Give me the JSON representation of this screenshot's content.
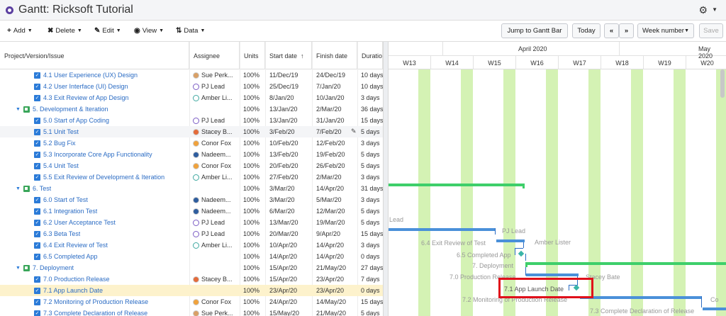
{
  "window": {
    "title": "Gantt:  Ricksoft Tutorial"
  },
  "toolbar": {
    "menus": [
      {
        "name": "add-menu",
        "icon": "plus-icon",
        "glyph": "+",
        "label": "Add"
      },
      {
        "name": "delete-menu",
        "icon": "x-circle-icon",
        "glyph": "✖",
        "label": "Delete"
      },
      {
        "name": "edit-menu",
        "icon": "pencil-icon",
        "glyph": "✎",
        "label": "Edit"
      },
      {
        "name": "view-menu",
        "icon": "eye-icon",
        "glyph": "◉",
        "label": "View"
      },
      {
        "name": "data-menu",
        "icon": "sort-icon",
        "glyph": "⇅",
        "label": "Data"
      }
    ],
    "jump_label": "Jump to Gantt Bar",
    "today_label": "Today",
    "prev_label": "«",
    "next_label": "»",
    "scale_label": "Week number",
    "save_label": "Save"
  },
  "grid": {
    "headers": {
      "issue": "Project/Version/Issue",
      "assignee": "Assignee",
      "units": "Units",
      "start": "Start date",
      "start_sort": "↑",
      "finish": "Finish date",
      "duration": "Duratio"
    },
    "rows": [
      {
        "type": "issue",
        "label": "4.1 User Experience (UX) Design",
        "assignee": "Sue Perk...",
        "avatar": "av-sue",
        "units": "100%",
        "start": "11/Dec/19",
        "finish": "24/Dec/19",
        "duration": "10 days"
      },
      {
        "type": "issue",
        "label": "4.2 User Interface (UI) Design",
        "assignee": "PJ Lead",
        "avatar": "av-pj",
        "units": "100%",
        "start": "25/Dec/19",
        "finish": "7/Jan/20",
        "duration": "10 days"
      },
      {
        "type": "issue",
        "label": "4.3 Exit Review of App Design",
        "assignee": "Amber Li...",
        "avatar": "av-amber",
        "units": "100%",
        "start": "8/Jan/20",
        "finish": "10/Jan/20",
        "duration": "3 days"
      },
      {
        "type": "version",
        "label": "5. Development & Iteration",
        "assignee": "",
        "avatar": "",
        "units": "100%",
        "start": "13/Jan/20",
        "finish": "2/Mar/20",
        "duration": "36 days"
      },
      {
        "type": "issue",
        "label": "5.0 Start of App Coding",
        "assignee": "PJ Lead",
        "avatar": "av-pj",
        "units": "100%",
        "start": "13/Jan/20",
        "finish": "31/Jan/20",
        "duration": "15 days"
      },
      {
        "type": "issue",
        "label": "5.1 Unit Test",
        "assignee": "Stacey B...",
        "avatar": "av-stacey",
        "units": "100%",
        "start": "3/Feb/20",
        "finish": "7/Feb/20",
        "duration": "5 days",
        "hover": true
      },
      {
        "type": "issue",
        "label": "5.2 Bug Fix",
        "assignee": "Conor Fox",
        "avatar": "av-conor",
        "units": "100%",
        "start": "10/Feb/20",
        "finish": "12/Feb/20",
        "duration": "3 days"
      },
      {
        "type": "issue",
        "label": "5.3 Incorporate Core App Functionality",
        "assignee": "Nadeem...",
        "avatar": "av-nadeem",
        "units": "100%",
        "start": "13/Feb/20",
        "finish": "19/Feb/20",
        "duration": "5 days"
      },
      {
        "type": "issue",
        "label": "5.4 Unit Test",
        "assignee": "Conor Fox",
        "avatar": "av-conor",
        "units": "100%",
        "start": "20/Feb/20",
        "finish": "26/Feb/20",
        "duration": "5 days"
      },
      {
        "type": "issue",
        "label": "5.5 Exit Review of Development & Iteration",
        "assignee": "Amber Li...",
        "avatar": "av-amber",
        "units": "100%",
        "start": "27/Feb/20",
        "finish": "2/Mar/20",
        "duration": "3 days"
      },
      {
        "type": "version",
        "label": "6. Test",
        "assignee": "",
        "avatar": "",
        "units": "100%",
        "start": "3/Mar/20",
        "finish": "14/Apr/20",
        "duration": "31 days"
      },
      {
        "type": "issue",
        "label": "6.0 Start of Test",
        "assignee": "Nadeem...",
        "avatar": "av-nadeem",
        "units": "100%",
        "start": "3/Mar/20",
        "finish": "5/Mar/20",
        "duration": "3 days"
      },
      {
        "type": "issue",
        "label": "6.1 Integration Test",
        "assignee": "Nadeem...",
        "avatar": "av-nadeem",
        "units": "100%",
        "start": "6/Mar/20",
        "finish": "12/Mar/20",
        "duration": "5 days"
      },
      {
        "type": "issue",
        "label": "6.2 User Acceptance Test",
        "assignee": "PJ Lead",
        "avatar": "av-pj",
        "units": "100%",
        "start": "13/Mar/20",
        "finish": "19/Mar/20",
        "duration": "5 days"
      },
      {
        "type": "issue",
        "label": "6.3 Beta Test",
        "assignee": "PJ Lead",
        "avatar": "av-pj",
        "units": "100%",
        "start": "20/Mar/20",
        "finish": "9/Apr/20",
        "duration": "15 days"
      },
      {
        "type": "issue",
        "label": "6.4 Exit Review of Test",
        "assignee": "Amber Li...",
        "avatar": "av-amber",
        "units": "100%",
        "start": "10/Apr/20",
        "finish": "14/Apr/20",
        "duration": "3 days"
      },
      {
        "type": "issue",
        "label": "6.5 Completed App",
        "assignee": "",
        "avatar": "",
        "units": "100%",
        "start": "14/Apr/20",
        "finish": "14/Apr/20",
        "duration": "0 days"
      },
      {
        "type": "version",
        "label": "7. Deployment",
        "assignee": "",
        "avatar": "",
        "units": "100%",
        "start": "15/Apr/20",
        "finish": "21/May/20",
        "duration": "27 days"
      },
      {
        "type": "issue",
        "label": "7.0 Production Release",
        "assignee": "Stacey B...",
        "avatar": "av-stacey",
        "units": "100%",
        "start": "15/Apr/20",
        "finish": "23/Apr/20",
        "duration": "7 days"
      },
      {
        "type": "issue",
        "label": "7.1 App Launch Date",
        "assignee": "",
        "avatar": "",
        "units": "100%",
        "start": "23/Apr/20",
        "finish": "23/Apr/20",
        "duration": "0 days",
        "selected": true
      },
      {
        "type": "issue",
        "label": "7.2 Monitoring of Production Release",
        "assignee": "Conor Fox",
        "avatar": "av-conor",
        "units": "100%",
        "start": "24/Apr/20",
        "finish": "14/May/20",
        "duration": "15 days"
      },
      {
        "type": "issue",
        "label": "7.3 Complete Declaration of Release",
        "assignee": "Sue Perk...",
        "avatar": "av-sue",
        "units": "100%",
        "start": "15/May/20",
        "finish": "21/May/20",
        "duration": "5 days"
      }
    ]
  },
  "chart": {
    "months": [
      "April 2020",
      "May 2020"
    ],
    "weeks": [
      "W13",
      "W14",
      "W15",
      "W16",
      "W17",
      "W18",
      "W19",
      "W20"
    ],
    "labels": {
      "lead_partial": "Lead",
      "pj_lead": "PJ Lead",
      "exit_review": "6.4 Exit Review of Test",
      "amber": "Amber Lister",
      "completed_app": "6.5 Completed App",
      "deployment": "7. Deployment",
      "production_release": "7.0 Production Release",
      "stacey": "Stacey Bate",
      "app_launch": "7.1 App Launch Date",
      "monitoring": "7.2 Monitoring of Production Release",
      "conor_partial": "Co",
      "complete_decl": "7.3 Complete Declaration of Release"
    }
  }
}
